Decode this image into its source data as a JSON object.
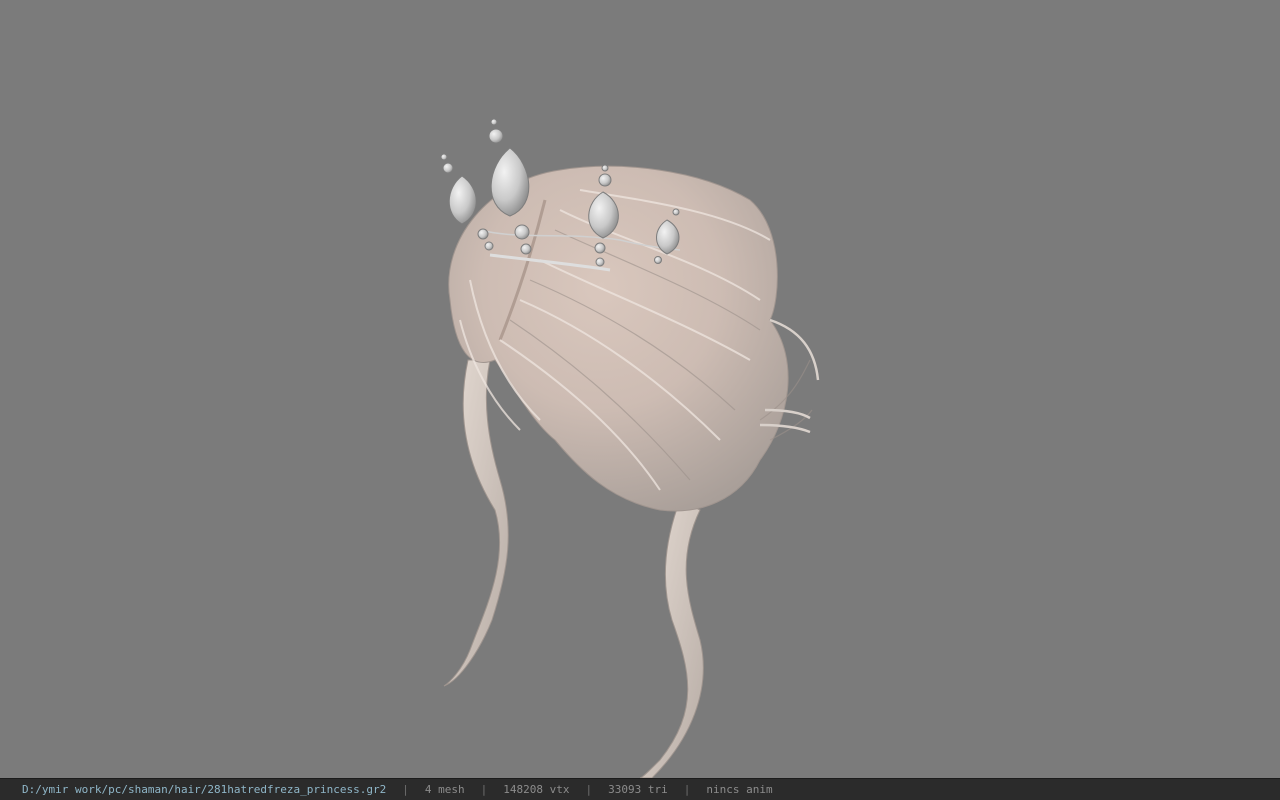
{
  "viewport": {
    "model_icon": "hair-model-with-tiara",
    "background_color": "#7b7b7b"
  },
  "status_bar": {
    "file_path": "D:/ymir work/pc/shaman/hair/281hatredfreza_princess.gr2",
    "separator": "|",
    "mesh_count": "4 mesh",
    "vertex_count": "148208 vtx",
    "triangle_count": "33093 tri",
    "animation": "nincs anim"
  }
}
